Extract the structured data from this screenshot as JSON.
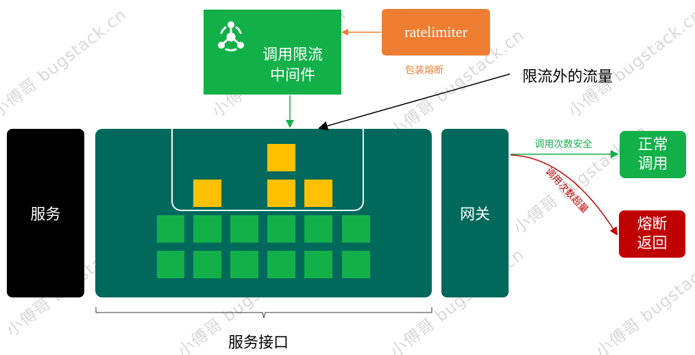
{
  "watermark": {
    "text": "小傅哥 bugstack.cn"
  },
  "middleware_box": {
    "line1": "调用限流",
    "line2": "中间件",
    "icon": "share-nodes-icon"
  },
  "ratelimiter_box": {
    "label": "ratelimiter"
  },
  "wrap_label": "包装熔断",
  "outer_traffic_label": "限流外的流量",
  "service_box": {
    "label": "服务"
  },
  "gateway_box": {
    "label": "网关"
  },
  "interface_label": "服务接口",
  "safe_call_label": "调用次数安全",
  "exceed_call_label": "调用次数超量",
  "normal_box": {
    "line1": "正常",
    "line2": "调用"
  },
  "break_box": {
    "line1": "熔断",
    "line2": "返回"
  },
  "colors": {
    "teal": "#00695c",
    "middleware_green": "#13b049",
    "ratelimiter_orange": "#ed7d31",
    "normal_green": "#13b049",
    "break_red": "#c00000",
    "yellow": "#ffc000"
  }
}
